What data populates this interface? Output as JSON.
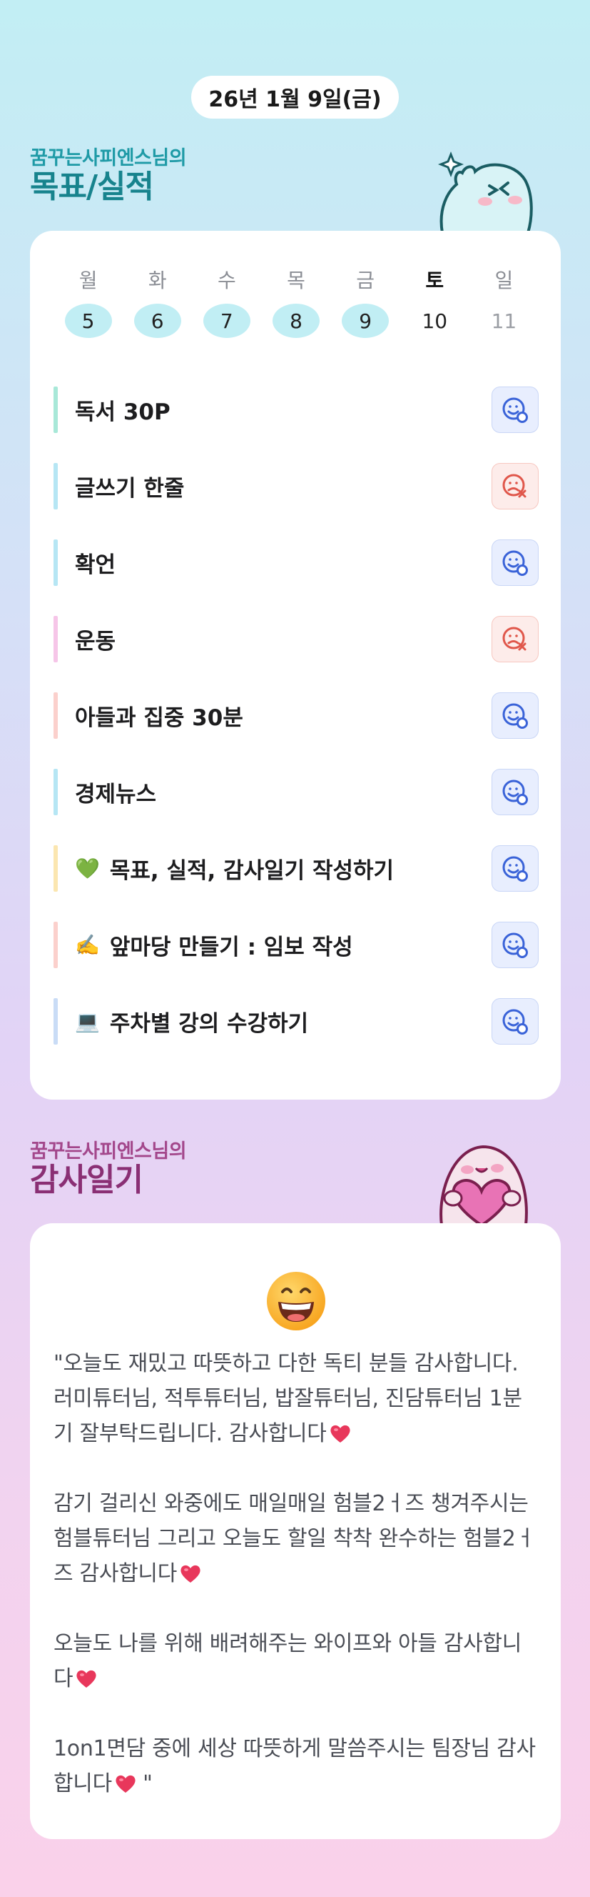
{
  "date": "26년 1월 9일(금)",
  "goals_section": {
    "subtitle": "꿈꾸는사피엔스님의",
    "title": "목표/실적"
  },
  "week": [
    {
      "label": "월",
      "num": "5",
      "state": "done"
    },
    {
      "label": "화",
      "num": "6",
      "state": "done"
    },
    {
      "label": "수",
      "num": "7",
      "state": "done"
    },
    {
      "label": "목",
      "num": "8",
      "state": "done"
    },
    {
      "label": "금",
      "num": "9",
      "state": "done"
    },
    {
      "label": "토",
      "num": "10",
      "state": "plain"
    },
    {
      "label": "일",
      "num": "11",
      "state": "sun"
    }
  ],
  "goals": [
    {
      "text": "독서 30P",
      "emoji": "",
      "bar_color": "#a8e8d8",
      "status": "done"
    },
    {
      "text": "글쓰기 한줄",
      "emoji": "",
      "bar_color": "#b6e6f4",
      "status": "missed"
    },
    {
      "text": "확언",
      "emoji": "",
      "bar_color": "#b6e6f4",
      "status": "done"
    },
    {
      "text": "운동",
      "emoji": "",
      "bar_color": "#f6c5e8",
      "status": "missed"
    },
    {
      "text": "아들과 집중 30분",
      "emoji": "",
      "bar_color": "#fbd0cc",
      "status": "done"
    },
    {
      "text": "경제뉴스",
      "emoji": "",
      "bar_color": "#b6e6f4",
      "status": "done"
    },
    {
      "text": "목표, 실적, 감사일기 작성하기",
      "emoji": "💚",
      "bar_color": "#fbe6b0",
      "status": "done"
    },
    {
      "text": "앞마당 만들기 : 임보 작성",
      "emoji": "✍️",
      "bar_color": "#fbd0cc",
      "status": "done"
    },
    {
      "text": "주차별 강의 수강하기",
      "emoji": "💻",
      "bar_color": "#c9dcf6",
      "status": "done"
    }
  ],
  "gratitude_section": {
    "subtitle": "꿈꾸는사피엔스님의",
    "title": "감사일기"
  },
  "gratitude": [
    {
      "text": "\"오늘도 재밌고 따뜻하고 다한 독티 분들 감사합니다. 러미튜터님, 적투튜터님, 밥잘튜터님, 진담튜터님 1분기 잘부탁드립니다. 감사합니다",
      "heart": true,
      "closing": ""
    },
    {
      "text": "감기 걸리신 와중에도 매일매일 험블2ㅓ즈 챙겨주시는 험블튜터님 그리고 오늘도 할일 착착 완수하는 험블2ㅓ즈 감사합니다",
      "heart": true,
      "closing": ""
    },
    {
      "text": "오늘도 나를 위해 배려해주는 와이프와 아들 감사합니다",
      "heart": true,
      "closing": ""
    },
    {
      "text": "1on1면담 중에 세상 따뜻하게 말씀주시는 팀장님 감사합니다",
      "heart": true,
      "closing": " \""
    }
  ],
  "colors": {
    "done_circle": "#c1eef4",
    "status_ok_icon": "#3a63d8",
    "status_missed_icon": "#e0574b",
    "heart": "#e8375b"
  },
  "icons": {
    "status_done": "smile-check-icon",
    "status_missed": "frown-x-icon",
    "big_emoji": "grinning-face-icon",
    "heart": "heart-icon"
  }
}
